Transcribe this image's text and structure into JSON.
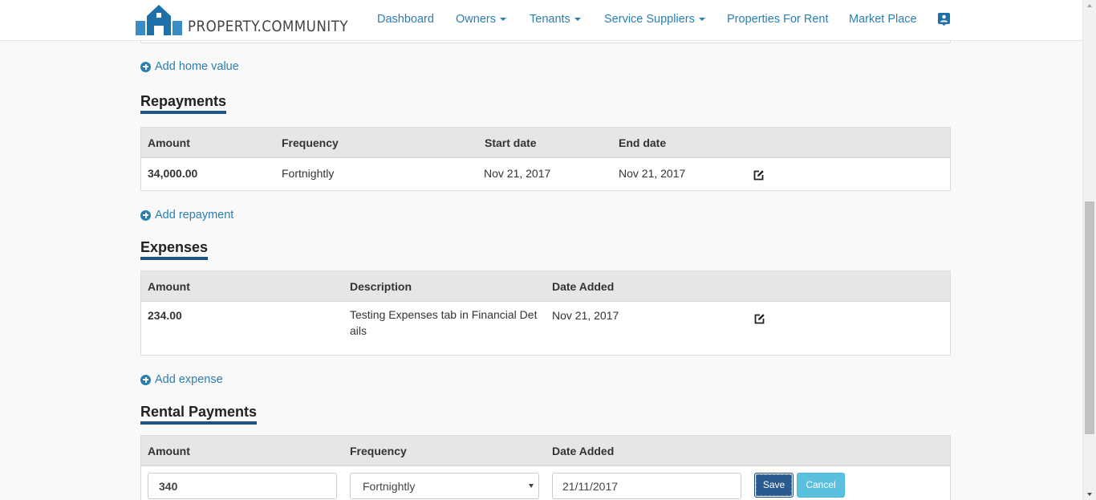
{
  "brand": {
    "logo_text": "PROPERTY.COMMUNITY"
  },
  "nav": {
    "dashboard": "Dashboard",
    "owners": "Owners",
    "tenants": "Tenants",
    "service_suppliers": "Service Suppliers",
    "properties_for_rent": "Properties For Rent",
    "market_place": "Market Place",
    "user_icon": "user-card-icon"
  },
  "home_value": {
    "add_label": "Add home value"
  },
  "repayments": {
    "title": "Repayments",
    "columns": [
      "Amount",
      "Frequency",
      "Start date",
      "End date"
    ],
    "rows": [
      {
        "amount": "34,000.00",
        "frequency": "Fortnightly",
        "start_date": "Nov 21, 2017",
        "end_date": "Nov 21, 2017"
      }
    ],
    "add_label": "Add repayment"
  },
  "expenses": {
    "title": "Expenses",
    "columns": [
      "Amount",
      "Description",
      "Date Added"
    ],
    "rows": [
      {
        "amount": "234.00",
        "description": "Testing Expenses tab in Financial Det ails",
        "date_added": "Nov 21, 2017"
      }
    ],
    "add_label": "Add expense"
  },
  "rental_payments": {
    "title": "Rental Payments",
    "columns": [
      "Amount",
      "Frequency",
      "Date Added"
    ],
    "edit_row": {
      "amount": "340",
      "frequency": "Fortnightly",
      "date_added": "21/11/2017",
      "save_label": "Save",
      "cancel_label": "Cancel"
    }
  },
  "colors": {
    "link": "#2a7fb0",
    "accent_underline": "#1e5384",
    "save": "#2a5b8e",
    "cancel": "#5bc0de"
  }
}
